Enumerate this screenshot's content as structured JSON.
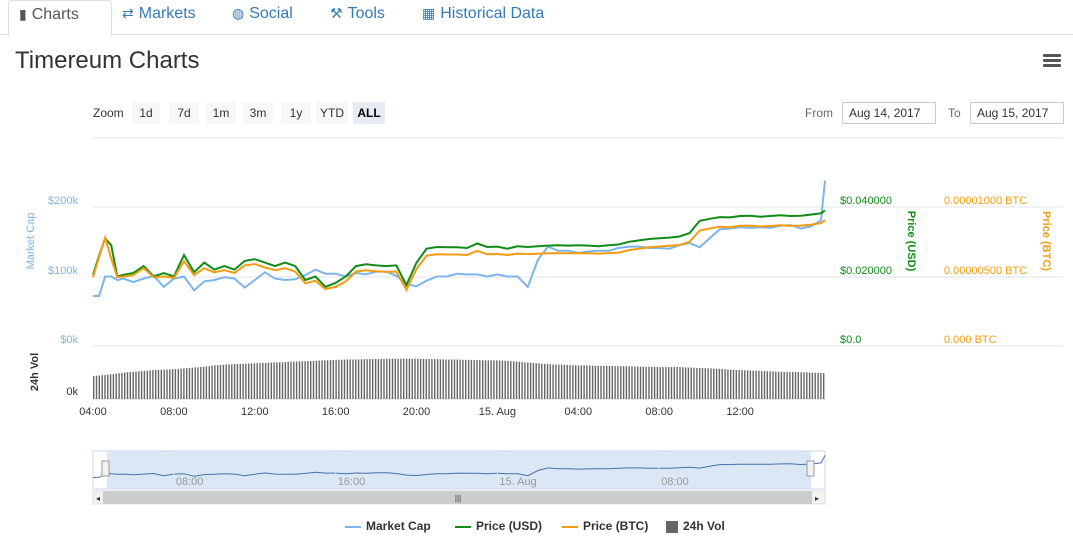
{
  "tabs": [
    {
      "label": "Charts",
      "icon": "bar-chart-icon",
      "glyph": "▮"
    },
    {
      "label": "Markets",
      "icon": "exchange-icon",
      "glyph": "⇄"
    },
    {
      "label": "Social",
      "icon": "globe-icon",
      "glyph": "◍"
    },
    {
      "label": "Tools",
      "icon": "wrench-icon",
      "glyph": "🔧"
    },
    {
      "label": "Historical Data",
      "icon": "calendar-icon",
      "glyph": "▦"
    }
  ],
  "page_title": "Timereum Charts",
  "zoom": {
    "label": "Zoom",
    "buttons": [
      "1d",
      "7d",
      "1m",
      "3m",
      "1y",
      "YTD",
      "ALL"
    ],
    "selected": "ALL"
  },
  "range": {
    "from_label": "From",
    "from_value": "Aug 14, 2017",
    "to_label": "To",
    "to_value": "Aug 15, 2017"
  },
  "colors": {
    "market_cap": "#7cb5ec",
    "price_usd": "#108c17",
    "price_btc": "#f39c12",
    "volume": "#666666",
    "volume_axis": "#333333"
  },
  "chart_data": {
    "type": "line",
    "x_ticks": [
      "04:00",
      "08:00",
      "12:00",
      "16:00",
      "20:00",
      "15. Aug",
      "04:00",
      "08:00",
      "12:00"
    ],
    "navigator_ticks": [
      "08:00",
      "16:00",
      "15. Aug",
      "08:00"
    ],
    "y_axes": {
      "market_cap": {
        "title": "Market Cap",
        "ticks": [
          "$0k",
          "$100k",
          "$200k"
        ],
        "range": [
          0,
          200000
        ]
      },
      "price_usd": {
        "title": "Price (USD)",
        "ticks": [
          "$0.0",
          "$0.020000",
          "$0.040000"
        ],
        "range": [
          0,
          0.04
        ]
      },
      "price_btc": {
        "title": "Price (BTC)",
        "ticks": [
          "0.000 BTC",
          "0.00000500 BTC",
          "0.00001000 BTC"
        ],
        "range": [
          0,
          1e-05
        ]
      },
      "volume": {
        "title": "24h Vol",
        "ticks": [
          "0k"
        ]
      }
    },
    "x_hours": [
      0,
      0.3,
      0.6,
      0.9,
      1.2,
      1.5,
      2.0,
      2.5,
      3.0,
      3.5,
      4.0,
      4.5,
      5.0,
      5.5,
      6.0,
      6.5,
      7.0,
      7.5,
      8.0,
      8.5,
      9.0,
      9.5,
      10.0,
      10.5,
      11.0,
      11.5,
      12.0,
      12.5,
      13.0,
      13.5,
      14.0,
      14.5,
      15.0,
      15.5,
      16.0,
      16.5,
      17.0,
      17.5,
      18.0,
      18.5,
      19.0,
      19.5,
      20.0,
      20.5,
      21.0,
      21.5,
      22.0,
      22.5,
      23.0,
      23.5,
      24.0,
      24.5,
      25.0,
      25.5,
      26.0,
      26.5,
      27.0,
      27.5,
      28.0,
      28.5,
      29.0,
      29.5,
      30.0,
      30.5,
      31.0,
      31.5,
      32.0,
      32.5,
      33.0,
      33.5,
      34.0,
      34.5,
      35.0,
      35.5,
      36.0,
      36.2
    ],
    "series": [
      {
        "name": "Market Cap",
        "values": [
          72000,
          72000,
          100000,
          100000,
          95000,
          97000,
          92000,
          97000,
          101000,
          85000,
          97000,
          100000,
          80000,
          93000,
          95000,
          99000,
          97000,
          84000,
          95000,
          106000,
          97000,
          95000,
          96000,
          102000,
          110000,
          104000,
          104000,
          100000,
          105000,
          103000,
          107000,
          107000,
          101000,
          89000,
          86000,
          94000,
          100000,
          100000,
          104000,
          103000,
          103000,
          100000,
          103000,
          100000,
          100000,
          85000,
          124000,
          143000,
          137000,
          137000,
          134000,
          136000,
          137000,
          137000,
          141000,
          143000,
          143000,
          141000,
          141000,
          140000,
          145000,
          148000,
          142000,
          155000,
          168000,
          169000,
          171000,
          170000,
          171000,
          170000,
          173000,
          174000,
          169000,
          172000,
          181000,
          238000
        ]
      },
      {
        "name": "Price (USD)",
        "values": [
          0.0205,
          0.026,
          0.031,
          0.029,
          0.02,
          0.0205,
          0.021,
          0.023,
          0.02,
          0.021,
          0.02,
          0.0262,
          0.0212,
          0.024,
          0.022,
          0.023,
          0.022,
          0.0245,
          0.025,
          0.024,
          0.023,
          0.024,
          0.023,
          0.019,
          0.02,
          0.017,
          0.0182,
          0.02,
          0.023,
          0.0235,
          0.0232,
          0.023,
          0.0232,
          0.0175,
          0.024,
          0.028,
          0.0285,
          0.0284,
          0.0284,
          0.0282,
          0.0295,
          0.0285,
          0.0286,
          0.028,
          0.0287,
          0.0285,
          0.0287,
          0.0289,
          0.029,
          0.0289,
          0.029,
          0.0289,
          0.0287,
          0.029,
          0.0292,
          0.03,
          0.0304,
          0.0308,
          0.031,
          0.0312,
          0.0315,
          0.0325,
          0.036,
          0.0366,
          0.0371,
          0.037,
          0.0374,
          0.0375,
          0.0372,
          0.0374,
          0.0376,
          0.0374,
          0.0375,
          0.0378,
          0.0382,
          0.039
        ]
      },
      {
        "name": "Price (BTC)",
        "values": [
          4.95e-06,
          6.4e-06,
          7.8e-06,
          6.3e-06,
          4.95e-06,
          5e-06,
          5.1e-06,
          5.6e-06,
          4.95e-06,
          5e-06,
          4.9e-06,
          6.1e-06,
          5.1e-06,
          5.6e-06,
          5.3e-06,
          5.45e-06,
          5.25e-06,
          5.8e-06,
          5.9e-06,
          5.65e-06,
          5.45e-06,
          5.6e-06,
          5.35e-06,
          4.5e-06,
          4.7e-06,
          4.1e-06,
          4.25e-06,
          4.65e-06,
          5.35e-06,
          5.45e-06,
          5.38e-06,
          5.33e-06,
          5.36e-06,
          4.05e-06,
          5.55e-06,
          6.5e-06,
          6.6e-06,
          6.58e-06,
          6.58e-06,
          6.55e-06,
          6.85e-06,
          6.6e-06,
          6.62e-06,
          6.55e-06,
          6.65e-06,
          6.61e-06,
          6.63e-06,
          6.67e-06,
          6.68e-06,
          6.67e-06,
          6.68e-06,
          6.66e-06,
          6.65e-06,
          6.68e-06,
          6.72e-06,
          6.9e-06,
          7e-06,
          7.11e-06,
          7.16e-06,
          7.21e-06,
          7.26e-06,
          7.5e-06,
          8.3e-06,
          8.45e-06,
          8.58e-06,
          8.55e-06,
          8.65e-06,
          8.66e-06,
          8.6e-06,
          8.63e-06,
          8.68e-06,
          8.64e-06,
          8.66e-06,
          8.73e-06,
          8.84e-06,
          9.05e-06
        ]
      },
      {
        "name": "24h Vol",
        "values": [
          0.55,
          0.56,
          0.58,
          0.59,
          0.61,
          0.63,
          0.65,
          0.67,
          0.69,
          0.7,
          0.71,
          0.73,
          0.75,
          0.77,
          0.8,
          0.82,
          0.83,
          0.84,
          0.85,
          0.86,
          0.87,
          0.88,
          0.89,
          0.9,
          0.91,
          0.92,
          0.93,
          0.94,
          0.94,
          0.95,
          0.95,
          0.96,
          0.96,
          0.96,
          0.96,
          0.95,
          0.95,
          0.94,
          0.94,
          0.93,
          0.93,
          0.92,
          0.92,
          0.91,
          0.89,
          0.87,
          0.85,
          0.83,
          0.82,
          0.81,
          0.8,
          0.8,
          0.79,
          0.79,
          0.78,
          0.78,
          0.77,
          0.77,
          0.76,
          0.76,
          0.76,
          0.75,
          0.74,
          0.73,
          0.72,
          0.7,
          0.69,
          0.68,
          0.67,
          0.66,
          0.65,
          0.64,
          0.64,
          0.63,
          0.62,
          0.62
        ]
      }
    ]
  },
  "legend": [
    {
      "label": "Market Cap",
      "color": "#7cb5ec",
      "kind": "line"
    },
    {
      "label": "Price (USD)",
      "color": "#108c17",
      "kind": "line"
    },
    {
      "label": "Price (BTC)",
      "color": "#f39c12",
      "kind": "line"
    },
    {
      "label": "24h Vol",
      "color": "#666666",
      "kind": "box"
    }
  ]
}
